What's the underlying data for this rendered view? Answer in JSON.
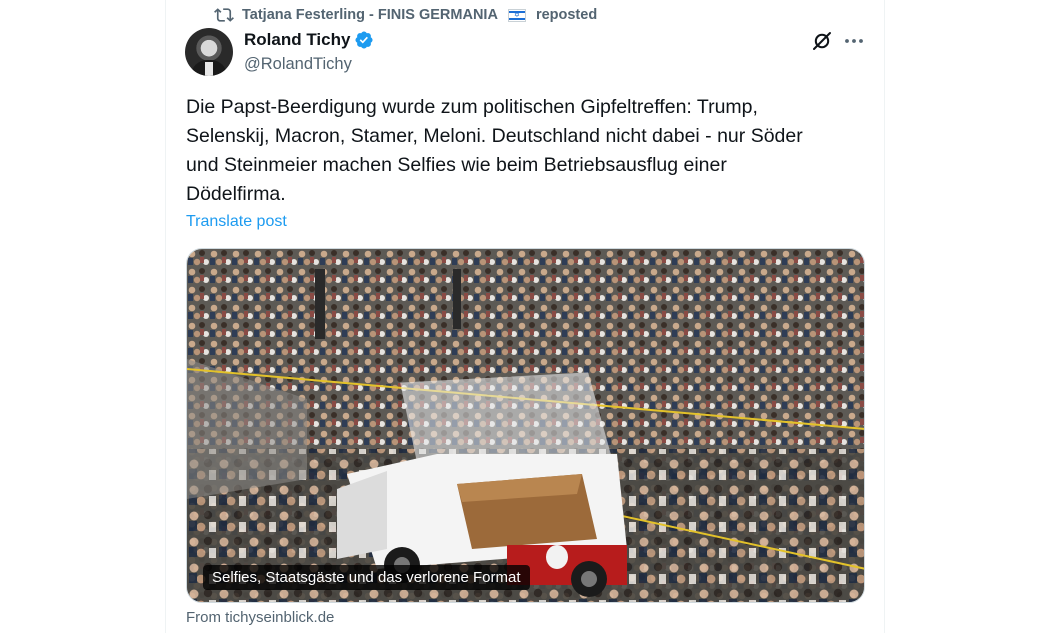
{
  "repost": {
    "icon": "repost-icon",
    "user": "Tatjana Festerling - FINIS GERMANIA",
    "flag": "israel-flag-icon",
    "suffix": "reposted"
  },
  "author": {
    "display_name": "Roland Tichy",
    "handle": "@RolandTichy",
    "verified_badge": "verified-badge-icon"
  },
  "actions": {
    "grok_icon": "grok-icon",
    "more_icon": "more-icon"
  },
  "post": {
    "text": "Die Papst-Beerdigung wurde zum politischen Gipfeltreffen: Trump,\nSelenskij, Macron, Stamer, Meloni. Deutschland nicht dabei - nur Söder\nund Steinmeier machen Selfies wie beim Betriebsausflug einer\nDödelfirma.",
    "translate_label": "Translate post"
  },
  "link_card": {
    "title": "Selfies, Staatsgäste und das verlorene Format",
    "source": "From tichyseinblick.de"
  },
  "colors": {
    "link": "#1d9bf0",
    "secondary_text": "#536471",
    "verified": "#1d9bf0"
  }
}
